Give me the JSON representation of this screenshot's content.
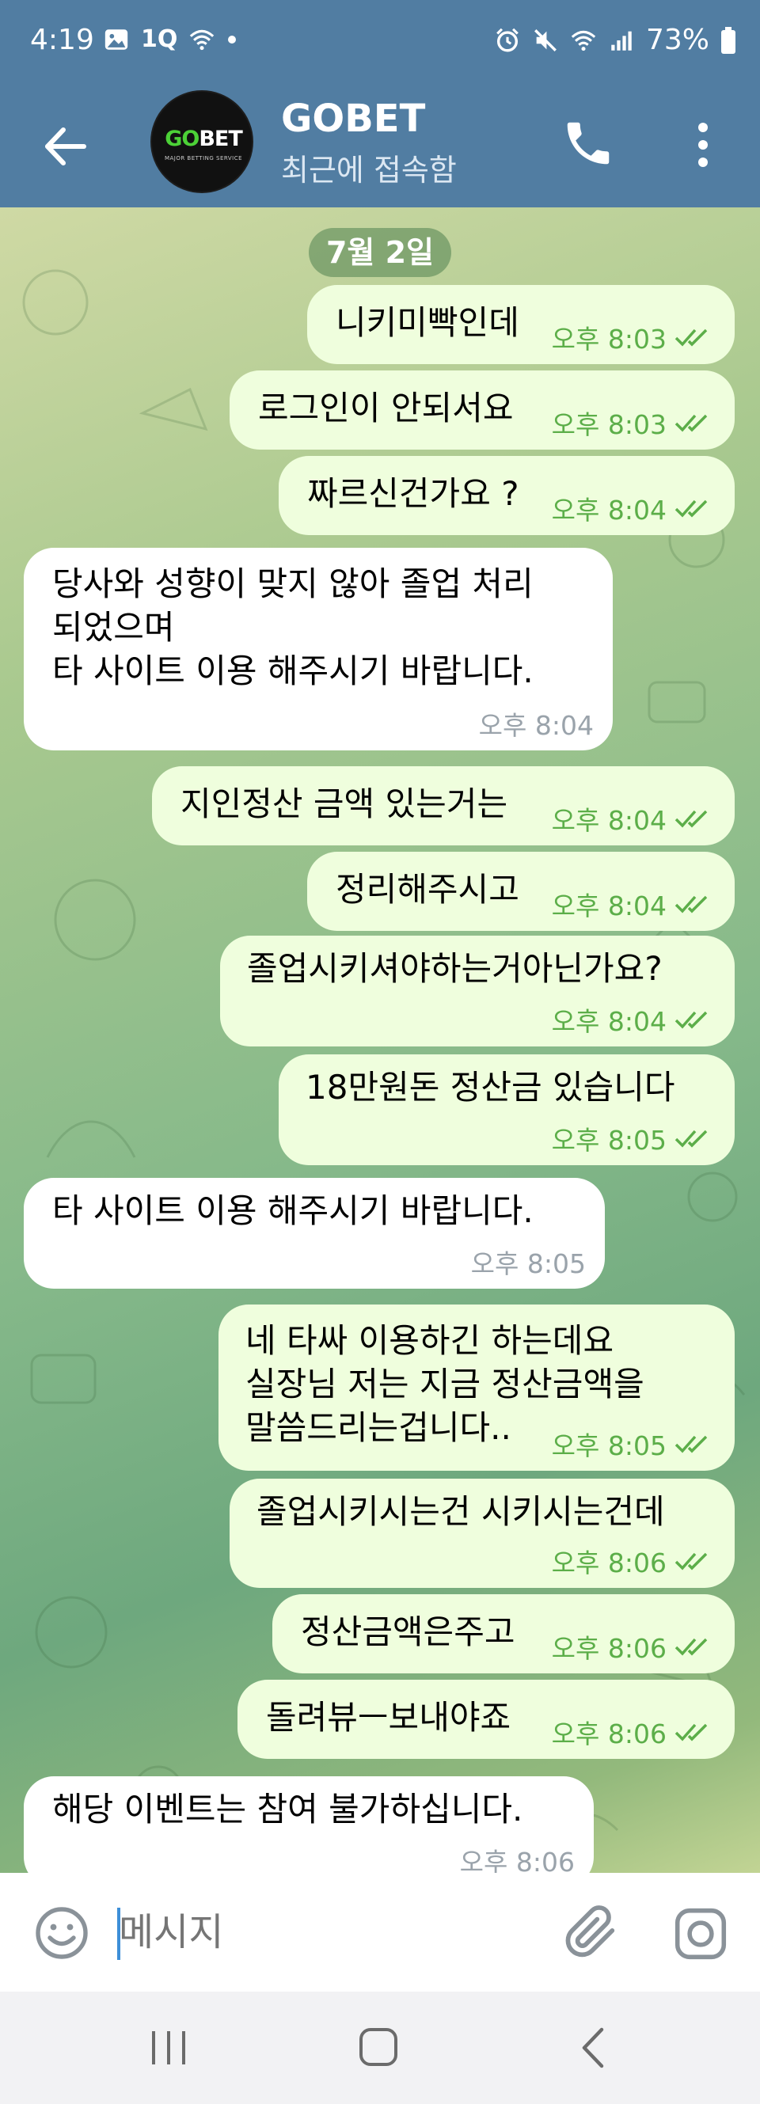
{
  "status_bar": {
    "time": "4:19",
    "battery": "73%",
    "left_icons": [
      "image-icon",
      "1q-icon",
      "wifi-signal-icon",
      "dot-icon"
    ],
    "right_icons": [
      "alarm-icon",
      "mute-icon",
      "wifi-icon",
      "signal-icon",
      "battery-icon"
    ],
    "left_label": "1Q"
  },
  "header": {
    "title": "GOBET",
    "status": "최근에 접속함",
    "avatar": {
      "logo_go": "GO",
      "logo_bet": "BET",
      "tagline": "MAJOR BETTING SERVICE"
    }
  },
  "chat": {
    "date_label": "7월 2일",
    "messages": [
      {
        "dir": "out",
        "text": "니키미빡인데",
        "time": "오후 8:03"
      },
      {
        "dir": "out",
        "text": "로그인이 안되서요",
        "time": "오후 8:03"
      },
      {
        "dir": "out",
        "text": "짜르신건가요 ?",
        "time": "오후 8:04"
      },
      {
        "dir": "in",
        "text": "당사와 성향이 맞지 않아 졸업 처리\n되었으며\n타 사이트 이용 해주시기 바랍니다.",
        "time": "오후 8:04"
      },
      {
        "dir": "out",
        "text": "지인정산 금액 있는거는",
        "time": "오후 8:04"
      },
      {
        "dir": "out",
        "text": "정리해주시고",
        "time": "오후 8:04"
      },
      {
        "dir": "out",
        "text": "졸업시키셔야하는거아닌가요?",
        "time": "오후 8:04"
      },
      {
        "dir": "out",
        "text": "18만원돈 정산금 있습니다",
        "time": "오후 8:05"
      },
      {
        "dir": "in",
        "text": "타 사이트 이용 해주시기 바랍니다.",
        "time": "오후 8:05"
      },
      {
        "dir": "out",
        "text": "네 타싸 이용하긴 하는데요\n실장님 저는 지금 정산금액을\n말씀드리는겁니다..",
        "time": "오후 8:05"
      },
      {
        "dir": "out",
        "text": "졸업시키시는건 시키시는건데",
        "time": "오후 8:06"
      },
      {
        "dir": "out",
        "text": "정산금액은주고",
        "time": "오후 8:06"
      },
      {
        "dir": "out",
        "text": "돌려뷰ㅡ보내야죠",
        "time": "오후 8:06"
      },
      {
        "dir": "in",
        "text": "해당 이벤트는 참여 불가하십니다.",
        "time": "오후 8:06"
      }
    ]
  },
  "input": {
    "placeholder": "메시지"
  },
  "colors": {
    "header": "#517da2",
    "bubble_out": "#effedd",
    "bubble_in": "#ffffff",
    "check": "#5cae49"
  }
}
